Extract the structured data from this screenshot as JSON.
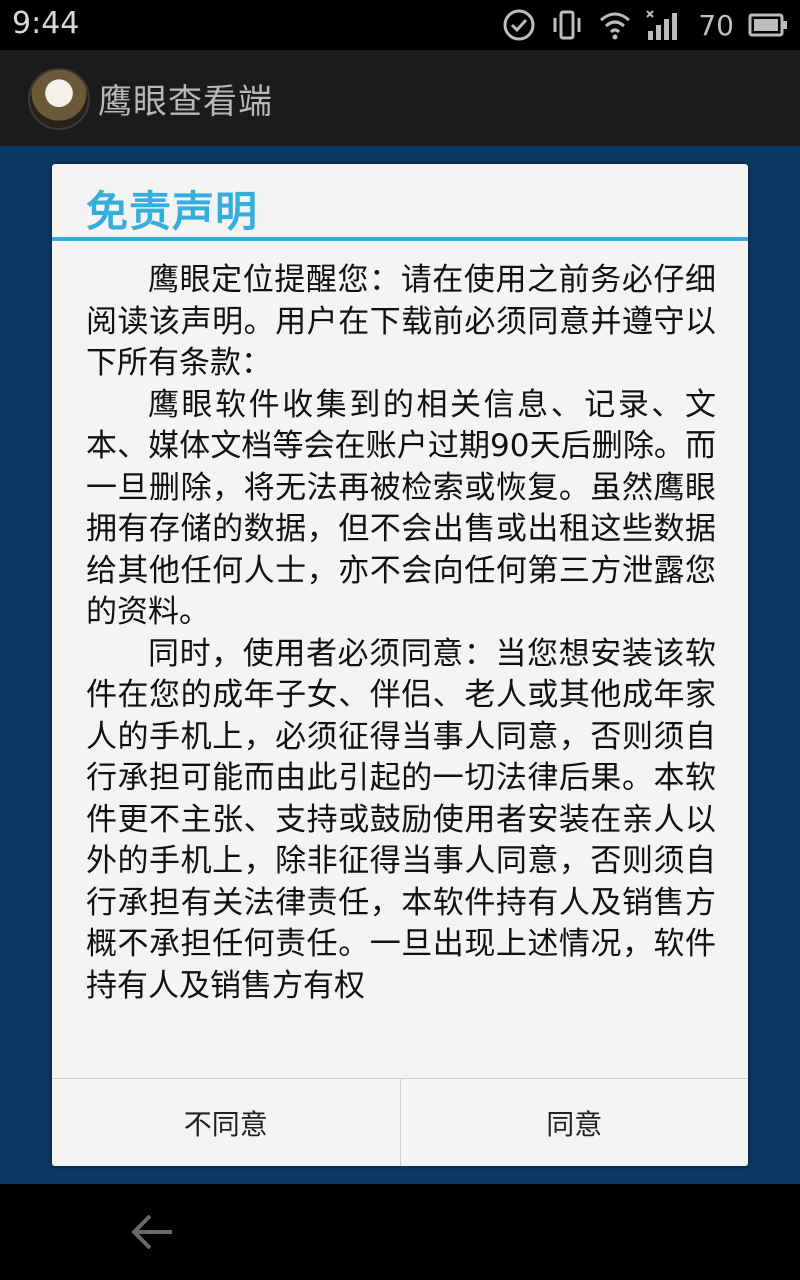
{
  "status_bar": {
    "time": "9:44",
    "battery_percent": "70"
  },
  "app_bar": {
    "title": "鹰眼查看端"
  },
  "dialog": {
    "title": "免责声明",
    "paragraphs": [
      "鹰眼定位提醒您：请在使用之前务必仔细阅读该声明。用户在下载前必须同意并遵守以下所有条款：",
      "鹰眼软件收集到的相关信息、记录、文本、媒体文档等会在账户过期90天后删除。而一旦删除，将无法再被检索或恢复。虽然鹰眼拥有存储的数据，但不会出售或出租这些数据给其他任何人士，亦不会向任何第三方泄露您的资料。",
      "同时，使用者必须同意：当您想安装该软件在您的成年子女、伴侣、老人或其他成年家人的手机上，必须征得当事人同意，否则须自行承担可能而由此引起的一切法律后果。本软件更不主张、支持或鼓励使用者安装在亲人以外的手机上，除非征得当事人同意，否则须自行承担有关法律责任，本软件持有人及销售方概不承担任何责任。一旦出现上述情况，软件持有人及销售方有权"
    ],
    "disagree_label": "不同意",
    "agree_label": "同意"
  },
  "colors": {
    "accent": "#35aedd",
    "content_background": "#0d3a64"
  },
  "icons": {
    "status": [
      "check-circle-icon",
      "vibrate-icon",
      "wifi-icon",
      "signal-icon",
      "battery-icon"
    ],
    "nav": [
      "back-arrow-icon"
    ]
  }
}
